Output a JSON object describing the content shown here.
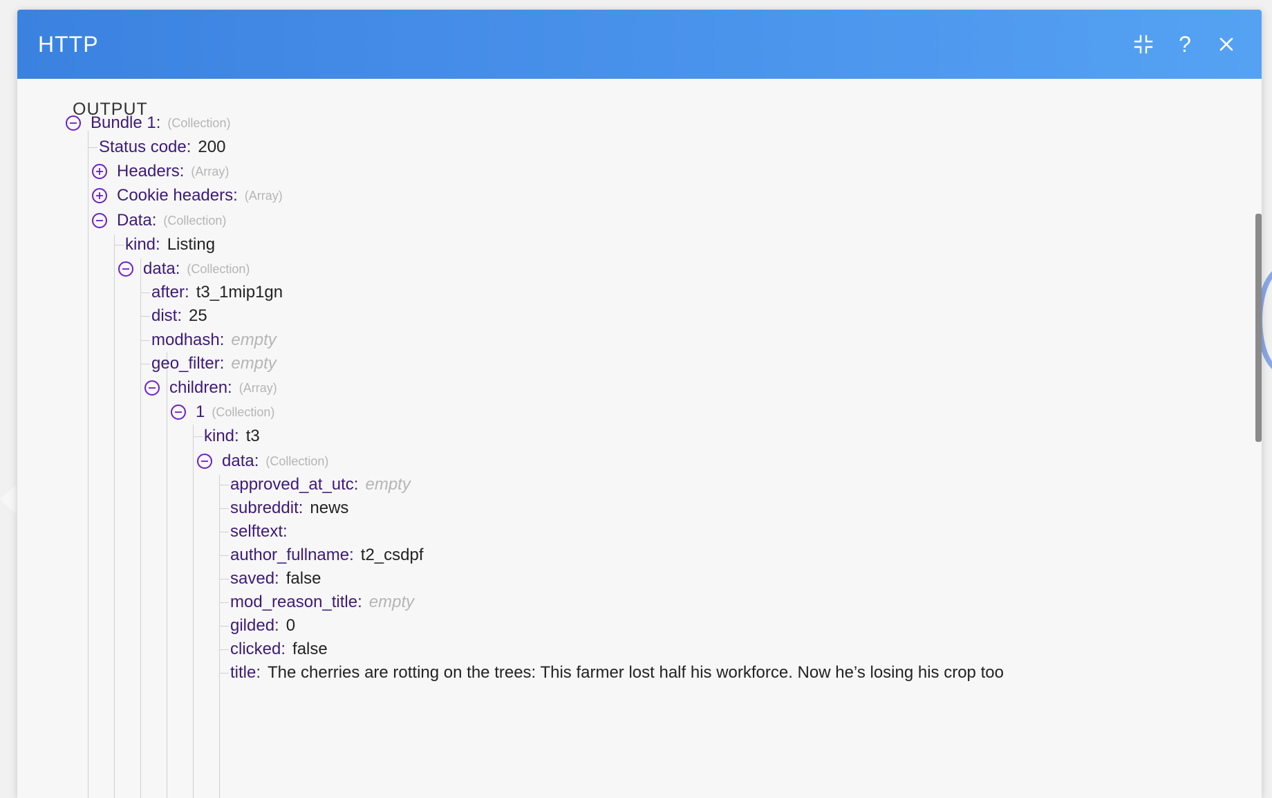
{
  "modal": {
    "title": "HTTP",
    "help_glyph": "?",
    "icons": [
      "collapse-icon",
      "help-icon",
      "close-icon"
    ],
    "accent_color": "#4a93ec",
    "tree_color": "#6a1fc5"
  },
  "output": {
    "section_title": "OUTPUT",
    "nodes": [
      {
        "key": "Bundle 1:",
        "type": "(Collection)",
        "toggle": "minus"
      },
      {
        "key": "Status code:",
        "value": "200"
      },
      {
        "key": "Headers:",
        "type": "(Array)",
        "toggle": "plus"
      },
      {
        "key": "Cookie headers:",
        "type": "(Array)",
        "toggle": "plus"
      },
      {
        "key": "Data:",
        "type": "(Collection)",
        "toggle": "minus"
      },
      {
        "key": "kind:",
        "value": "Listing"
      },
      {
        "key": "data:",
        "type": "(Collection)",
        "toggle": "minus"
      },
      {
        "key": "after:",
        "value": "t3_1mip1gn"
      },
      {
        "key": "dist:",
        "value": "25"
      },
      {
        "key": "modhash:",
        "value": "empty",
        "empty": true
      },
      {
        "key": "geo_filter:",
        "value": "empty",
        "empty": true
      },
      {
        "key": "children:",
        "type": "(Array)",
        "toggle": "minus"
      },
      {
        "key": "1",
        "type": "(Collection)",
        "toggle": "minus"
      },
      {
        "key": "kind:",
        "value": "t3"
      },
      {
        "key": "data:",
        "type": "(Collection)",
        "toggle": "minus"
      },
      {
        "key": "approved_at_utc:",
        "value": "empty",
        "empty": true
      },
      {
        "key": "subreddit:",
        "value": "news"
      },
      {
        "key": "selftext:",
        "value": ""
      },
      {
        "key": "author_fullname:",
        "value": "t2_csdpf"
      },
      {
        "key": "saved:",
        "value": "false"
      },
      {
        "key": "mod_reason_title:",
        "value": "empty",
        "empty": true
      },
      {
        "key": "gilded:",
        "value": "0"
      },
      {
        "key": "clicked:",
        "value": "false"
      },
      {
        "key": "title:",
        "value": "The cherries are rotting on the trees: This farmer lost half his workforce. Now he’s losing his crop too"
      }
    ]
  }
}
